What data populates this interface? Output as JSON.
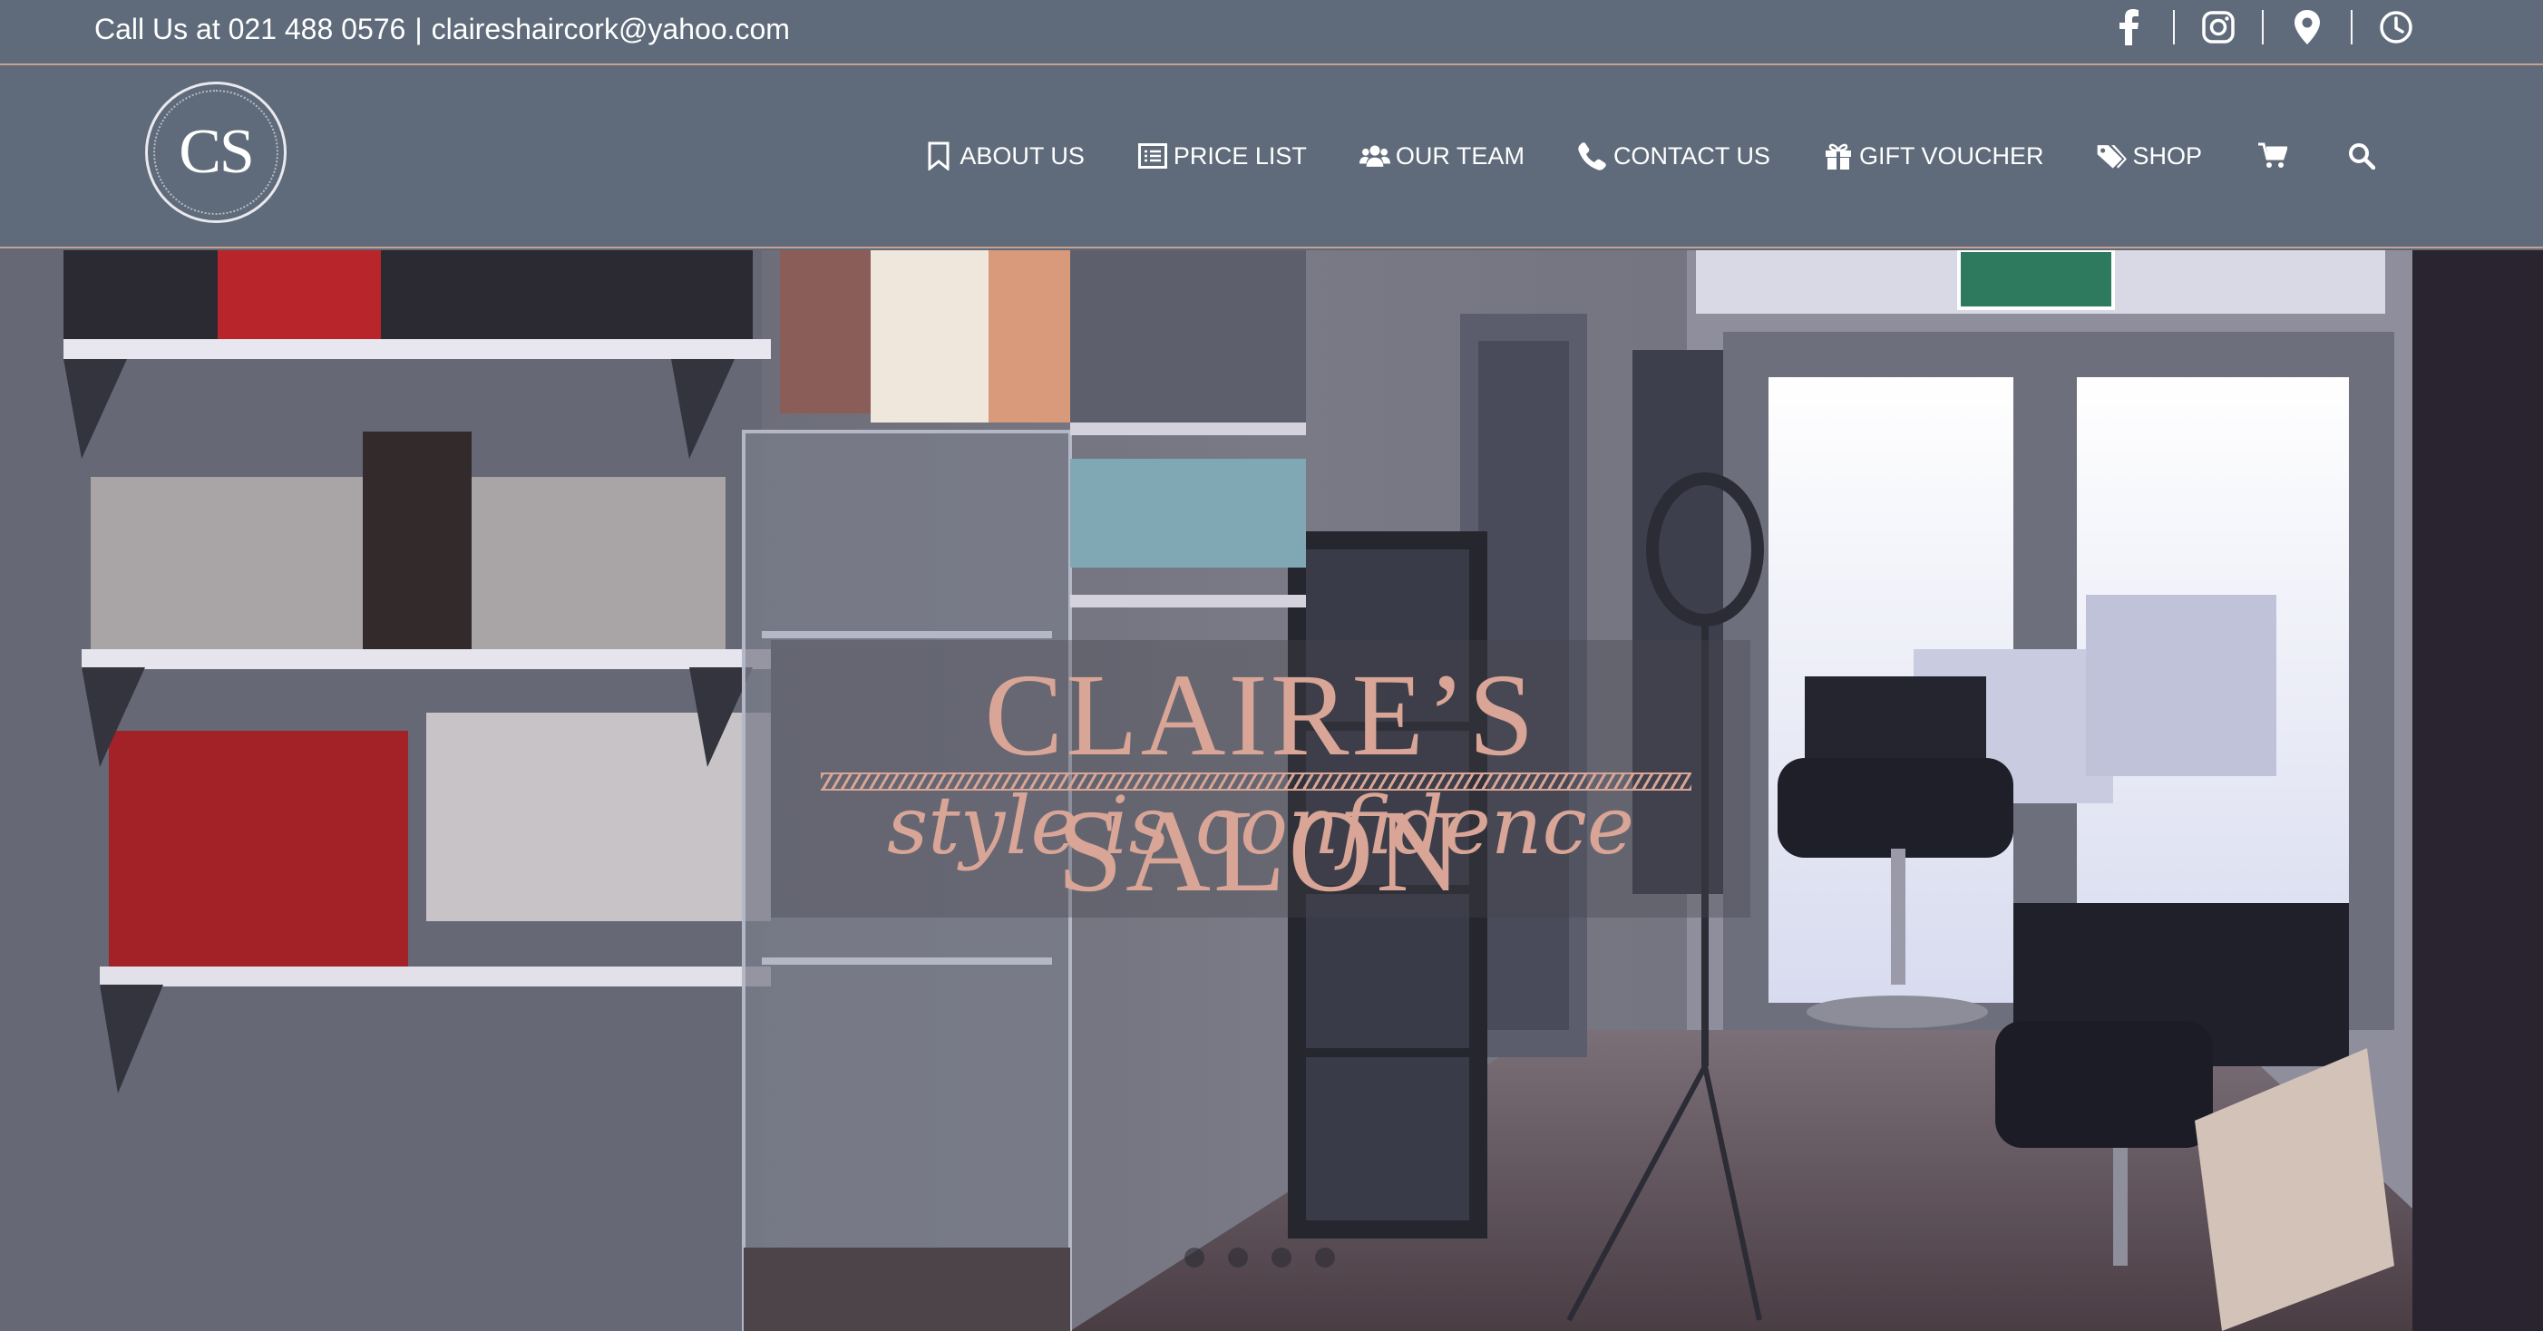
{
  "topbar": {
    "phone_text": "Call Us at 021 488 0576",
    "separator": "|",
    "email": "claireshaircork@yahoo.com",
    "social_icons": [
      "facebook-icon",
      "instagram-icon",
      "map-pin-icon",
      "clock-icon"
    ]
  },
  "logo": {
    "text": "CS"
  },
  "nav": {
    "items": [
      {
        "label": "ABOUT US",
        "icon": "bookmark-icon"
      },
      {
        "label": "PRICE LIST",
        "icon": "list-icon"
      },
      {
        "label": "OUR TEAM",
        "icon": "users-icon"
      },
      {
        "label": "CONTACT US",
        "icon": "phone-icon"
      },
      {
        "label": "GIFT VOUCHER",
        "icon": "gift-icon"
      },
      {
        "label": "SHOP",
        "icon": "tags-icon"
      }
    ],
    "cart_icon": "cart-icon",
    "search_icon": "search-icon"
  },
  "hero": {
    "title": "CLAIRE’S SALON",
    "tagline": "style is confidence",
    "slide_count": 4
  },
  "colors": {
    "header_bg": "#5f6b7a",
    "accent": "#c9a08e",
    "brand_pink": "#d8a596",
    "text_light": "#ffffff"
  }
}
